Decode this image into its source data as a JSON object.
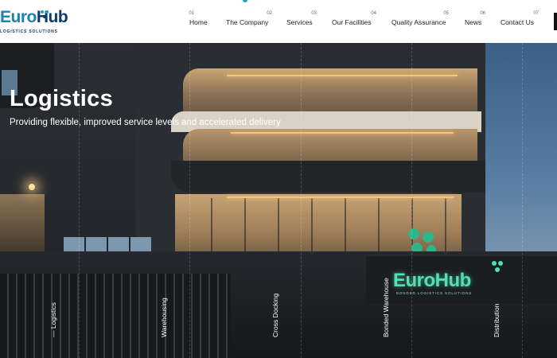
{
  "logo": {
    "part1": "Euro",
    "part2": "Hub",
    "tagline": "LOGISTICS SOLUTIONS"
  },
  "nav": [
    {
      "num": "01",
      "label": "Home"
    },
    {
      "num": "02",
      "label": "The Company"
    },
    {
      "num": "03",
      "label": "Services"
    },
    {
      "num": "04",
      "label": "Our Facilities"
    },
    {
      "num": "05",
      "label": "Quality Assurance"
    },
    {
      "num": "06",
      "label": "News"
    },
    {
      "num": "07",
      "label": "Contact Us"
    }
  ],
  "hero": {
    "title": "Logistics",
    "subtitle": "Providing flexible, improved service levels and accelerated delivery"
  },
  "categories": [
    {
      "label": "— Logistics"
    },
    {
      "label": "Warehousing"
    },
    {
      "label": "Cross Docking"
    },
    {
      "label": "Bonded Warehouse"
    },
    {
      "label": "Distribution"
    }
  ],
  "building_sign": {
    "part1": "Euro",
    "part2": "Hub",
    "tagline": "BONDED LOGISTICS SOLUTIONS"
  },
  "colors": {
    "accent": "#1aa0c8",
    "logo_dark": "#0b3b68",
    "sign_green": "#52e0b0"
  }
}
